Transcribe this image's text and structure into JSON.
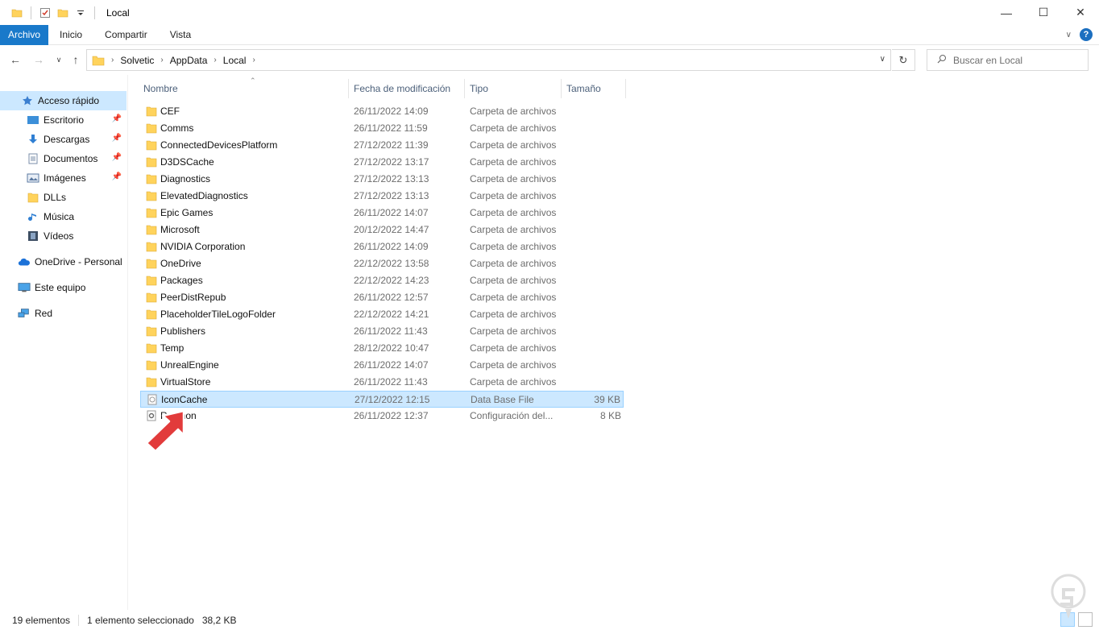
{
  "window": {
    "title": "Local",
    "controls": {
      "minimize": "—",
      "maximize": "☐",
      "close": "✕"
    }
  },
  "ribbon": {
    "tabs": [
      {
        "label": "Archivo",
        "active": true
      },
      {
        "label": "Inicio"
      },
      {
        "label": "Compartir"
      },
      {
        "label": "Vista"
      }
    ],
    "help": "?"
  },
  "address_bar": {
    "breadcrumbs": [
      "Solvetic",
      "AppData",
      "Local"
    ]
  },
  "search": {
    "placeholder": "Buscar en Local",
    "value": ""
  },
  "sidebar": {
    "items": [
      {
        "label": "Acceso rápido",
        "icon": "star-icon",
        "selected": true
      },
      {
        "label": "Escritorio",
        "icon": "desktop-icon",
        "pinned": true
      },
      {
        "label": "Descargas",
        "icon": "download-icon",
        "pinned": true
      },
      {
        "label": "Documentos",
        "icon": "document-icon",
        "pinned": true
      },
      {
        "label": "Imágenes",
        "icon": "pictures-icon",
        "pinned": true
      },
      {
        "label": "DLLs",
        "icon": "folder-icon"
      },
      {
        "label": "Música",
        "icon": "music-icon"
      },
      {
        "label": "Vídeos",
        "icon": "video-icon"
      },
      {
        "label": "OneDrive - Personal",
        "icon": "cloud-icon"
      },
      {
        "label": "Este equipo",
        "icon": "computer-icon"
      },
      {
        "label": "Red",
        "icon": "network-icon"
      }
    ]
  },
  "columns": {
    "name": "Nombre",
    "date": "Fecha de modificación",
    "type": "Tipo",
    "size": "Tamaño"
  },
  "files": [
    {
      "name": "CEF",
      "date": "26/11/2022 14:09",
      "type": "Carpeta de archivos",
      "size": "",
      "icon": "folder-icon"
    },
    {
      "name": "Comms",
      "date": "26/11/2022 11:59",
      "type": "Carpeta de archivos",
      "size": "",
      "icon": "folder-icon"
    },
    {
      "name": "ConnectedDevicesPlatform",
      "date": "27/12/2022 11:39",
      "type": "Carpeta de archivos",
      "size": "",
      "icon": "folder-icon"
    },
    {
      "name": "D3DSCache",
      "date": "27/12/2022 13:17",
      "type": "Carpeta de archivos",
      "size": "",
      "icon": "folder-icon"
    },
    {
      "name": "Diagnostics",
      "date": "27/12/2022 13:13",
      "type": "Carpeta de archivos",
      "size": "",
      "icon": "folder-icon"
    },
    {
      "name": "ElevatedDiagnostics",
      "date": "27/12/2022 13:13",
      "type": "Carpeta de archivos",
      "size": "",
      "icon": "folder-icon"
    },
    {
      "name": "Epic Games",
      "date": "26/11/2022 14:07",
      "type": "Carpeta de archivos",
      "size": "",
      "icon": "folder-icon"
    },
    {
      "name": "Microsoft",
      "date": "20/12/2022 14:47",
      "type": "Carpeta de archivos",
      "size": "",
      "icon": "folder-icon"
    },
    {
      "name": "NVIDIA Corporation",
      "date": "26/11/2022 14:09",
      "type": "Carpeta de archivos",
      "size": "",
      "icon": "folder-icon"
    },
    {
      "name": "OneDrive",
      "date": "22/12/2022 13:58",
      "type": "Carpeta de archivos",
      "size": "",
      "icon": "folder-icon"
    },
    {
      "name": "Packages",
      "date": "22/12/2022 14:23",
      "type": "Carpeta de archivos",
      "size": "",
      "icon": "folder-icon"
    },
    {
      "name": "PeerDistRepub",
      "date": "26/11/2022 12:57",
      "type": "Carpeta de archivos",
      "size": "",
      "icon": "folder-icon"
    },
    {
      "name": "PlaceholderTileLogoFolder",
      "date": "22/12/2022 14:21",
      "type": "Carpeta de archivos",
      "size": "",
      "icon": "folder-icon"
    },
    {
      "name": "Publishers",
      "date": "26/11/2022 11:43",
      "type": "Carpeta de archivos",
      "size": "",
      "icon": "folder-icon"
    },
    {
      "name": "Temp",
      "date": "28/12/2022 10:47",
      "type": "Carpeta de archivos",
      "size": "",
      "icon": "folder-icon"
    },
    {
      "name": "UnrealEngine",
      "date": "26/11/2022 14:07",
      "type": "Carpeta de archivos",
      "size": "",
      "icon": "folder-icon"
    },
    {
      "name": "VirtualStore",
      "date": "26/11/2022 11:43",
      "type": "Carpeta de archivos",
      "size": "",
      "icon": "folder-icon"
    },
    {
      "name": "IconCache",
      "date": "27/12/2022 12:15",
      "type": "Data Base File",
      "size": "39 KB",
      "icon": "database-file-icon",
      "selected": true
    },
    {
      "name": "Resmon",
      "date": "26/11/2022 12:37",
      "type": "Configuración del...",
      "size": "8 KB",
      "icon": "config-file-icon"
    }
  ],
  "status": {
    "count": "19 elementos",
    "selection": "1 elemento seleccionado",
    "selection_size": "38,2 KB"
  },
  "colors": {
    "accent": "#1979ca",
    "selection_bg": "#cce8ff",
    "selection_border": "#99d1ff",
    "folder": "#ffd35c",
    "arrow": "#e23b3b"
  }
}
